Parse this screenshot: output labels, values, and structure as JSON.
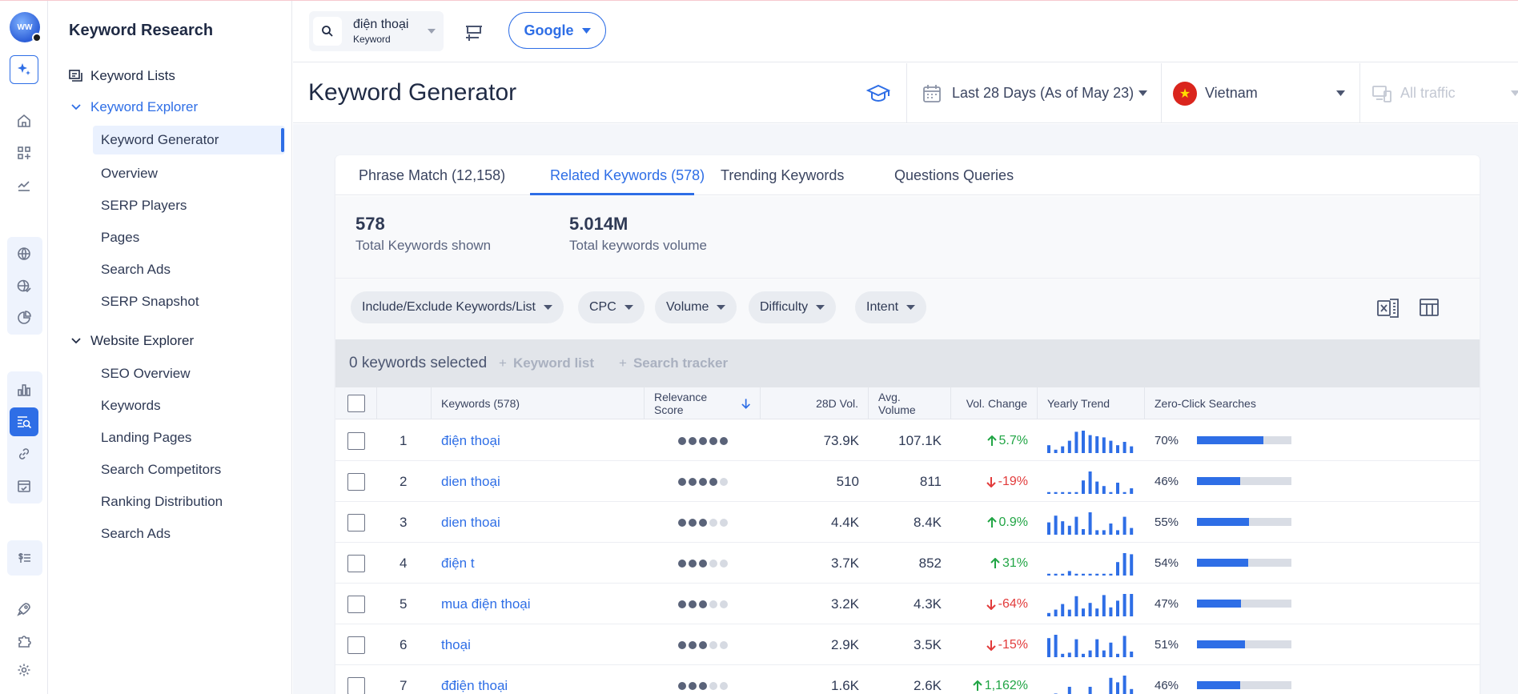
{
  "nav": {
    "title": "Keyword Research",
    "keyword_lists": "Keyword Lists",
    "keyword_explorer": "Keyword Explorer",
    "explorer_items": [
      "Keyword Generator",
      "Overview",
      "SERP Players",
      "Pages",
      "Search Ads",
      "SERP Snapshot"
    ],
    "website_explorer": "Website Explorer",
    "website_items": [
      "SEO Overview",
      "Keywords",
      "Landing Pages",
      "Search Competitors",
      "Ranking Distribution",
      "Search Ads"
    ]
  },
  "topbar": {
    "search_keyword": "điện thoại",
    "search_type": "Keyword",
    "engine": "Google"
  },
  "header": {
    "title": "Keyword Generator",
    "date_range": "Last 28 Days (As of May 23)",
    "country": "Vietnam",
    "traffic": "All traffic"
  },
  "tabs": [
    "Phrase Match (12,158)",
    "Related Keywords (578)",
    "Trending Keywords",
    "Questions Queries"
  ],
  "stats": {
    "total_keywords": "578",
    "total_keywords_label": "Total Keywords shown",
    "total_volume": "5.014M",
    "total_volume_label": "Total keywords volume"
  },
  "filters": [
    "Include/Exclude Keywords/List",
    "CPC",
    "Volume",
    "Difficulty",
    "Intent"
  ],
  "selection": {
    "selected": "0 keywords selected",
    "keyword_list": "Keyword list",
    "search_tracker": "Search tracker"
  },
  "columns": [
    "Keywords (578)",
    "Relevance Score",
    "28D Vol.",
    "Avg. Volume",
    "Vol. Change",
    "Yearly Trend",
    "Zero-Click Searches"
  ],
  "rows": [
    {
      "n": "1",
      "kw": "điện thoại",
      "rel": 5,
      "vol28": "73.9K",
      "avg": "107.1K",
      "chg": "5.7%",
      "dir": "up",
      "trend": [
        0.35,
        0.15,
        0.3,
        0.55,
        0.95,
        1,
        0.8,
        0.75,
        0.7,
        0.55,
        0.35,
        0.5,
        0.3
      ],
      "zc": "70%",
      "zcv": 70
    },
    {
      "n": "2",
      "kw": "dien thoại",
      "rel": 4,
      "vol28": "510",
      "avg": "811",
      "chg": "-19%",
      "dir": "down",
      "trend": [
        0.08,
        0.08,
        0.08,
        0.08,
        0.08,
        0.6,
        1,
        0.55,
        0.35,
        0.08,
        0.5,
        0.08,
        0.25
      ],
      "zc": "46%",
      "zcv": 46
    },
    {
      "n": "3",
      "kw": "dien thoai",
      "rel": 3,
      "vol28": "4.4K",
      "avg": "8.4K",
      "chg": "0.9%",
      "dir": "up",
      "trend": [
        0.55,
        0.85,
        0.6,
        0.4,
        0.8,
        0.25,
        1,
        0.2,
        0.2,
        0.5,
        0.2,
        0.8,
        0.3
      ],
      "zc": "55%",
      "zcv": 55
    },
    {
      "n": "4",
      "kw": "điện t",
      "rel": 3,
      "vol28": "3.7K",
      "avg": "852",
      "chg": "31%",
      "dir": "up",
      "trend": [
        0.08,
        0.08,
        0.08,
        0.2,
        0.08,
        0.08,
        0.08,
        0.08,
        0.08,
        0.08,
        0.6,
        1,
        0.95
      ],
      "zc": "54%",
      "zcv": 54
    },
    {
      "n": "5",
      "kw": "mua điện thoại",
      "rel": 3,
      "vol28": "3.2K",
      "avg": "4.3K",
      "chg": "-64%",
      "dir": "down",
      "trend": [
        0.15,
        0.3,
        0.55,
        0.3,
        0.9,
        0.35,
        0.6,
        0.35,
        0.95,
        0.4,
        0.7,
        1,
        1
      ],
      "zc": "47%",
      "zcv": 47
    },
    {
      "n": "6",
      "kw": "thoại",
      "rel": 3,
      "vol28": "2.9K",
      "avg": "3.5K",
      "chg": "-15%",
      "dir": "down",
      "trend": [
        0.85,
        1,
        0.15,
        0.2,
        0.8,
        0.15,
        0.3,
        0.8,
        0.3,
        0.65,
        0.15,
        0.95,
        0.25
      ],
      "zc": "51%",
      "zcv": 51
    },
    {
      "n": "7",
      "kw": "đđiện thoại",
      "rel": 3,
      "vol28": "1.6K",
      "avg": "2.6K",
      "chg": "1,162%",
      "dir": "up",
      "trend": [
        0.08,
        0.2,
        0.08,
        0.5,
        0.08,
        0.08,
        0.5,
        0.08,
        0.08,
        0.9,
        0.7,
        1,
        0.4
      ],
      "zc": "46%",
      "zcv": 46
    }
  ]
}
